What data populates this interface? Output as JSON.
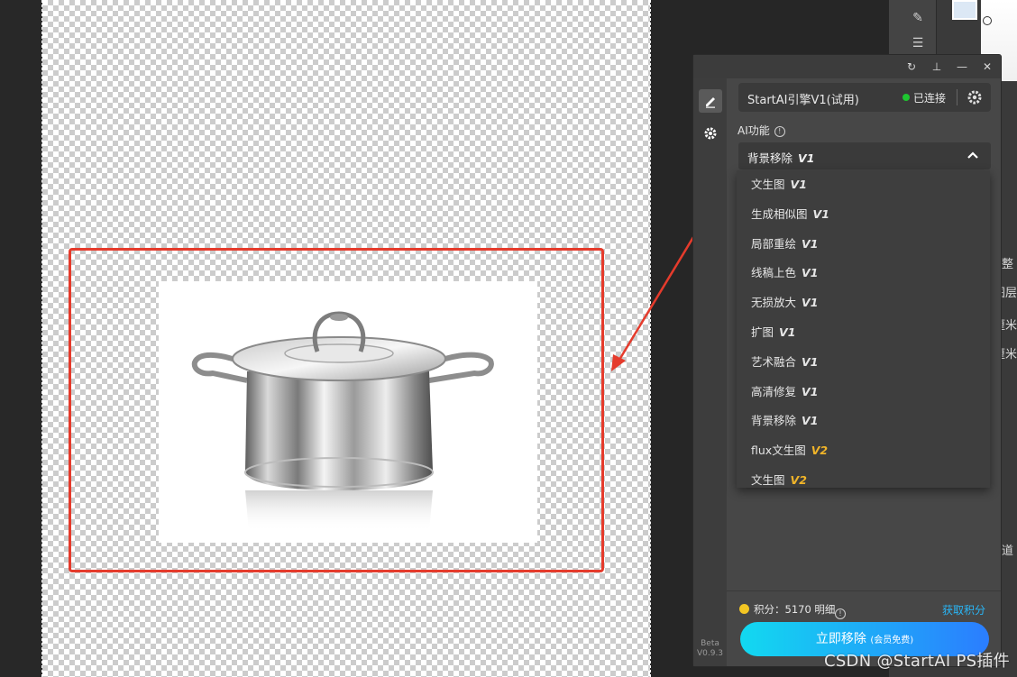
{
  "plugin": {
    "engine_title": "StartAI引擎V1(试用)",
    "status": "已连接",
    "function_label": "AI功能",
    "selected_function": "背景移除",
    "selected_version": "V1",
    "options": [
      {
        "label": "文生图",
        "version": "V1"
      },
      {
        "label": "生成相似图",
        "version": "V1"
      },
      {
        "label": "局部重绘",
        "version": "V1"
      },
      {
        "label": "线稿上色",
        "version": "V1"
      },
      {
        "label": "无损放大",
        "version": "V1"
      },
      {
        "label": "扩图",
        "version": "V1"
      },
      {
        "label": "艺术融合",
        "version": "V1"
      },
      {
        "label": "高清修复",
        "version": "V1"
      },
      {
        "label": "背景移除",
        "version": "V1"
      },
      {
        "label": "flux文生图",
        "version": "V2"
      },
      {
        "label": "文生图",
        "version": "V2"
      }
    ],
    "points_label": "积分：5170 明细",
    "get_points": "获取积分",
    "action_main": "立即移除",
    "action_sub": "(会员免费)",
    "version_line1": "Beta",
    "version_line2": "V0.9.3"
  },
  "side_labels": [
    "整",
    "图层",
    "厘米",
    "厘米",
    "道"
  ],
  "watermark": "CSDN @StartAI PS插件",
  "colors": {
    "annotation_red": "#e53b2c",
    "status_green": "#1ec530",
    "link_blue": "#29b6f6",
    "v2_gold": "#f0b429"
  },
  "icons": {
    "refresh": "refresh-icon",
    "pin": "pin-icon",
    "minimize": "minimize-icon",
    "close": "close-icon",
    "edit": "edit-icon",
    "settings": "gear-icon"
  }
}
